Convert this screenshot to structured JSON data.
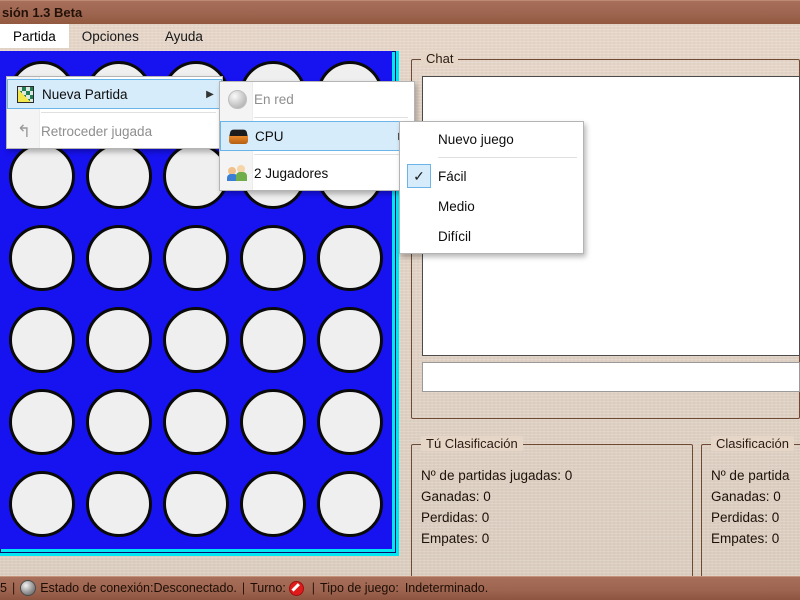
{
  "window": {
    "title": "sión 1.3 Beta"
  },
  "menubar": {
    "items": [
      {
        "label": "Partida",
        "open": true
      },
      {
        "label": "Opciones",
        "open": false
      },
      {
        "label": "Ayuda",
        "open": false
      }
    ]
  },
  "menu_partida": {
    "items": [
      {
        "label": "Nueva Partida",
        "icon": "board-icon",
        "submenu": true,
        "selected": true,
        "disabled": false
      },
      {
        "label": "Retroceder jugada",
        "icon": "undo-icon",
        "submenu": false,
        "selected": false,
        "disabled": true
      }
    ]
  },
  "menu_nueva_partida": {
    "items": [
      {
        "label": "En red",
        "icon": "network-icon",
        "submenu": false,
        "selected": false,
        "disabled": true
      },
      {
        "label": "CPU",
        "icon": "cpu-icon",
        "submenu": true,
        "selected": true,
        "disabled": false
      },
      {
        "label": "2 Jugadores",
        "icon": "two-players-icon",
        "submenu": false,
        "selected": false,
        "disabled": false
      }
    ]
  },
  "menu_cpu": {
    "items": [
      {
        "label": "Nuevo juego",
        "checked": false
      },
      {
        "label": "Fácil",
        "checked": true
      },
      {
        "label": "Medio",
        "checked": false
      },
      {
        "label": "Difícil",
        "checked": false
      }
    ]
  },
  "board": {
    "columns": 5,
    "rows": 6,
    "board_color": "#1712f0",
    "frame_color": "#00e7f4",
    "slot_color": "#efefef",
    "cells": [
      [
        "empty",
        "empty",
        "empty",
        "empty",
        "empty"
      ],
      [
        "empty",
        "empty",
        "empty",
        "empty",
        "empty"
      ],
      [
        "empty",
        "empty",
        "empty",
        "empty",
        "empty"
      ],
      [
        "empty",
        "empty",
        "empty",
        "empty",
        "empty"
      ],
      [
        "empty",
        "empty",
        "empty",
        "empty",
        "empty"
      ],
      [
        "empty",
        "empty",
        "empty",
        "empty",
        "empty"
      ]
    ]
  },
  "chat": {
    "legend": "Chat",
    "log_text": "",
    "input_value": "",
    "input_placeholder": ""
  },
  "stats_self": {
    "legend": "Tú Clasificación",
    "lines": [
      "Nº de partidas jugadas: 0",
      "Ganadas: 0",
      "Perdidas: 0",
      "Empates: 0"
    ]
  },
  "stats_other": {
    "legend": "Clasificación",
    "lines": [
      "Nº de partida",
      "Ganadas: 0",
      "Perdidas: 0",
      "Empates: 0"
    ]
  },
  "statusbar": {
    "left_fragment": "5",
    "connection_label": "Estado de conexión:Desconectado.",
    "turn_label": "Turno:",
    "turn_icon": "prohibited-icon",
    "gametype_label": "Tipo de juego:",
    "gametype_value": "Indeterminado.",
    "separator": "|"
  }
}
